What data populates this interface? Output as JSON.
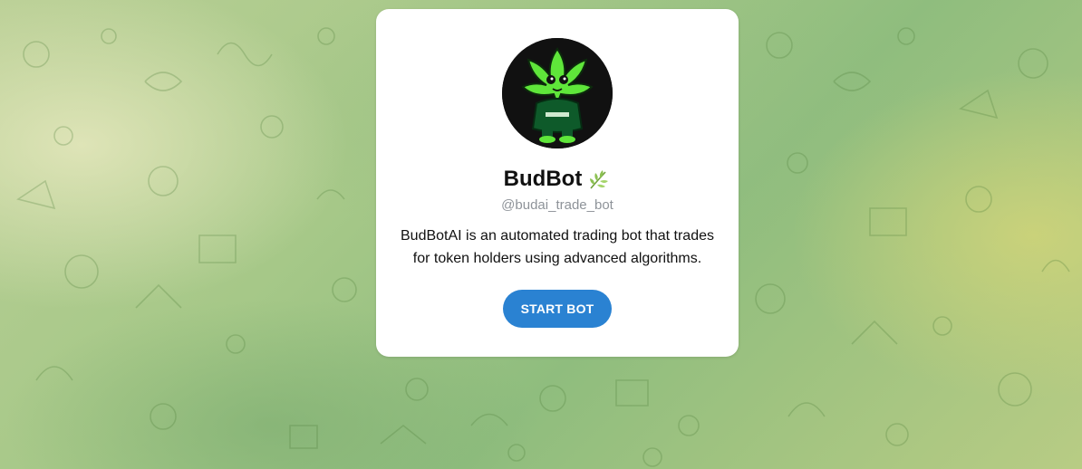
{
  "bot": {
    "name": "BudBot",
    "name_icon": "leaf-icon",
    "username": "@budai_trade_bot",
    "description": "BudBotAI is an automated trading bot that trades for token holders using advanced algorithms.",
    "avatar_icon": "cannabis-leaf-mascot-avatar"
  },
  "actions": {
    "start_label": "START BOT"
  },
  "colors": {
    "button": "#2a82d2",
    "card": "#ffffff",
    "background": "#a6c888"
  }
}
